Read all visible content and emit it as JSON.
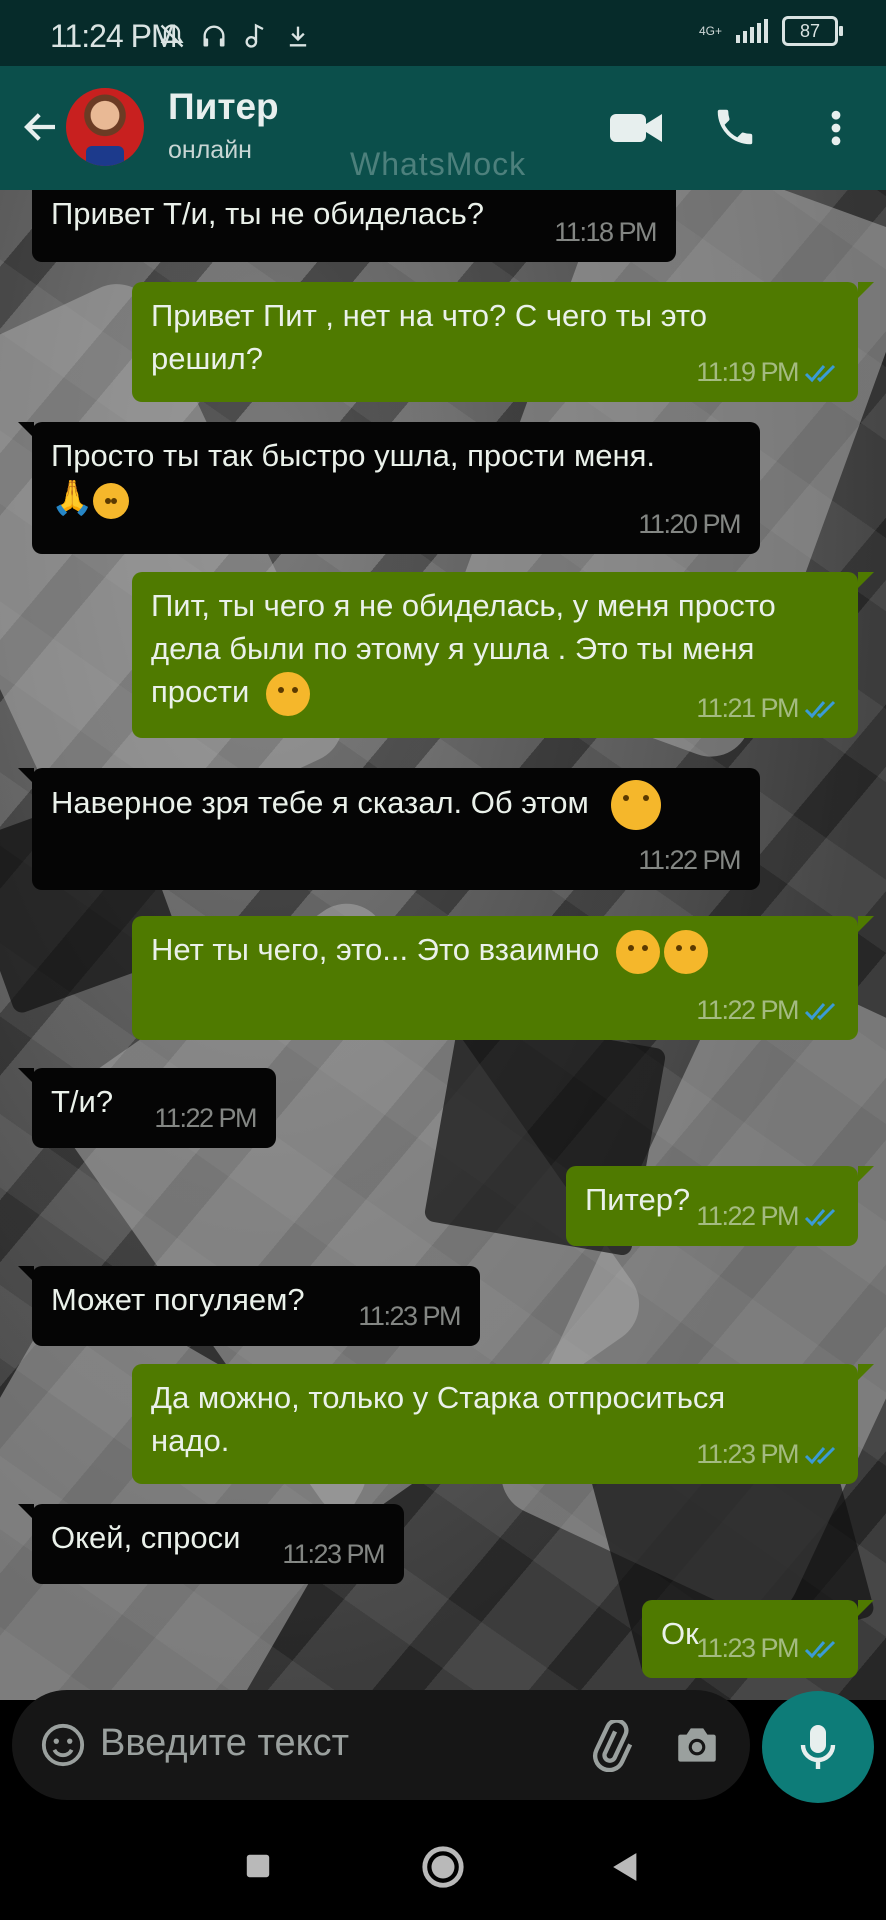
{
  "status_bar": {
    "time": "11:24 PM",
    "network": "4G+",
    "battery": "87"
  },
  "header": {
    "contact_name": "Питер",
    "contact_status": "онлайн",
    "watermark": "WhatsMock"
  },
  "messages": [
    {
      "dir": "in",
      "text": "Привет Т/и, ты не обиделась?",
      "time": "11:18 PM"
    },
    {
      "dir": "out",
      "text": "Привет Пит , нет на что? С чего ты это\nрешил?",
      "time": "11:19 PM"
    },
    {
      "dir": "in",
      "text": "Просто ты так быстро ушла, прости меня.",
      "time": "11:20 PM"
    },
    {
      "dir": "out",
      "text": "Пит, ты чего я не обиделась, у меня просто\nдела были по этому я ушла . Это ты меня\nпрости",
      "time": "11:21 PM"
    },
    {
      "dir": "in",
      "text": "Наверное зря тебе я сказал. Об этом",
      "time": "11:22 PM"
    },
    {
      "dir": "out",
      "text": "Нет ты чего, это... Это взаимно",
      "time": "11:22 PM"
    },
    {
      "dir": "in",
      "text": "Т/и?",
      "time": "11:22 PM"
    },
    {
      "dir": "out",
      "text": "Питер?",
      "time": "11:22 PM"
    },
    {
      "dir": "in",
      "text": "Может погуляем?",
      "time": "11:23 PM"
    },
    {
      "dir": "out",
      "text": "Да можно, только у Старка отпроситься\nнадо.",
      "time": "11:23 PM"
    },
    {
      "dir": "in",
      "text": "Окей, спроси",
      "time": "11:23 PM"
    },
    {
      "dir": "out",
      "text": "Ок",
      "time": "11:23 PM"
    }
  ],
  "composer": {
    "placeholder": "Введите текст"
  },
  "icons": [
    "back-arrow",
    "video-call",
    "phone",
    "more-vert",
    "emoji",
    "attach",
    "camera",
    "mic",
    "nav-recents",
    "nav-home",
    "nav-back"
  ],
  "colors": {
    "header": "#0b4f4b",
    "status_bar": "#062b2a",
    "incoming_bubble": "#050505",
    "outgoing_bubble": "#4f7a00",
    "mic_button": "#0d7c78",
    "read_ticks": "#3a9bd6"
  }
}
